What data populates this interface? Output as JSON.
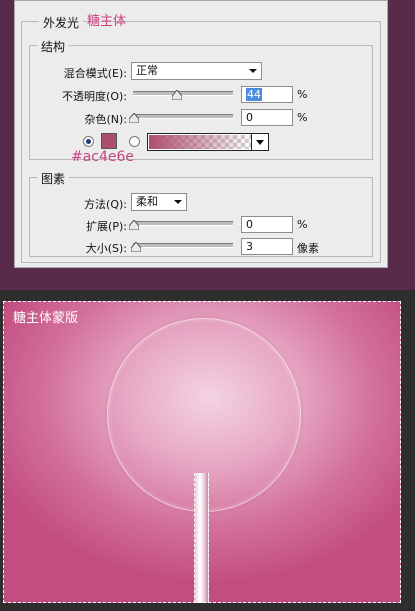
{
  "dialog": {
    "title": "外发光",
    "annotation_main": "糖主体",
    "structure": {
      "legend": "结构",
      "blend_mode_label": "混合模式(E):",
      "blend_mode_value": "正常",
      "opacity_label": "不透明度(O):",
      "opacity_value": "44",
      "opacity_unit": "%",
      "noise_label": "杂色(N):",
      "noise_value": "0",
      "noise_unit": "%",
      "color_hex_note": "#ac4e6e",
      "swatch_color": "#ac4e6e",
      "color_radio_selected": true,
      "gradient_radio_selected": false
    },
    "elements": {
      "legend": "图素",
      "technique_label": "方法(Q):",
      "technique_value": "柔和",
      "spread_label": "扩展(P):",
      "spread_value": "0",
      "spread_unit": "%",
      "size_label": "大小(S):",
      "size_value": "3",
      "size_unit": "像素"
    }
  },
  "canvas": {
    "label": "糖主体蒙版"
  },
  "colors": {
    "accent_pink": "#c8457e",
    "background": "#5a2a4a",
    "selection_highlight": "#4d8be0"
  }
}
